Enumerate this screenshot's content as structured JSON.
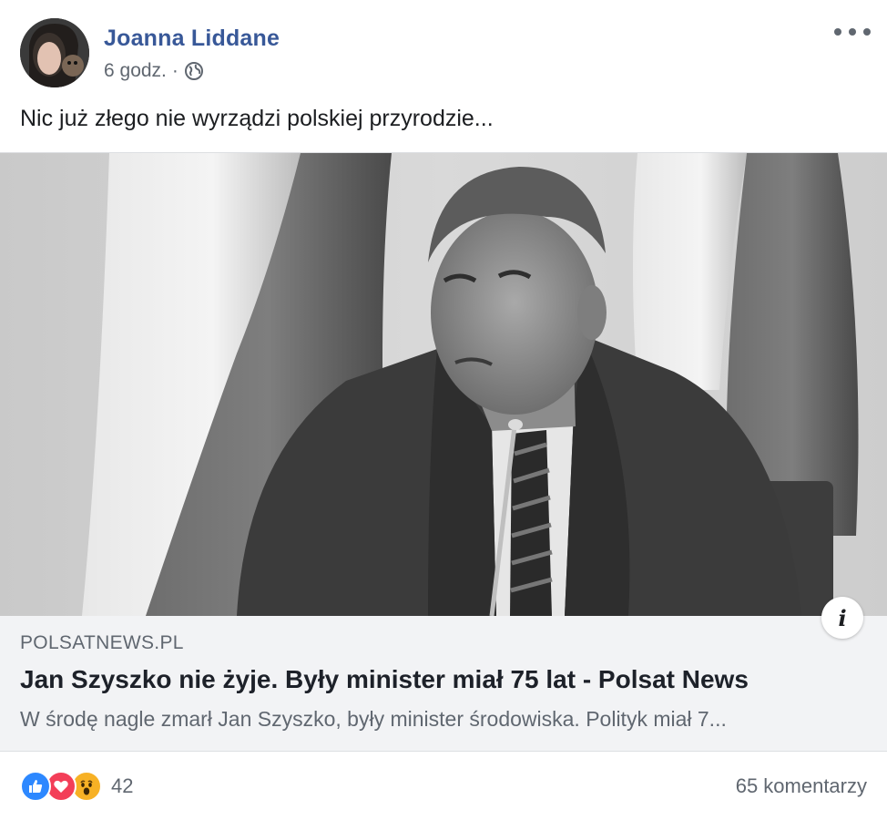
{
  "post": {
    "author": "Joanna Liddane",
    "time": "6 godz.",
    "separator": "·",
    "privacy_icon": "globe-icon",
    "text": "Nic już złego nie wyrządzi polskiej przyrodzie..."
  },
  "link": {
    "domain": "POLSATNEWS.PL",
    "title": "Jan Szyszko nie żyje. Były minister miał 75 lat - Polsat News",
    "description": "W środę nagle zmarł Jan Szyszko, były minister środowiska. Polityk miał 7...",
    "info_label": "i"
  },
  "footer": {
    "reaction_count": "42",
    "comments": "65 komentarzy",
    "reaction_icons": [
      "like-icon",
      "love-icon",
      "wow-icon"
    ]
  },
  "colors": {
    "author_link": "#385898",
    "secondary_text": "#606770",
    "like": "#2d88ff",
    "love": "#f33e58",
    "wow": "#f7b125"
  }
}
